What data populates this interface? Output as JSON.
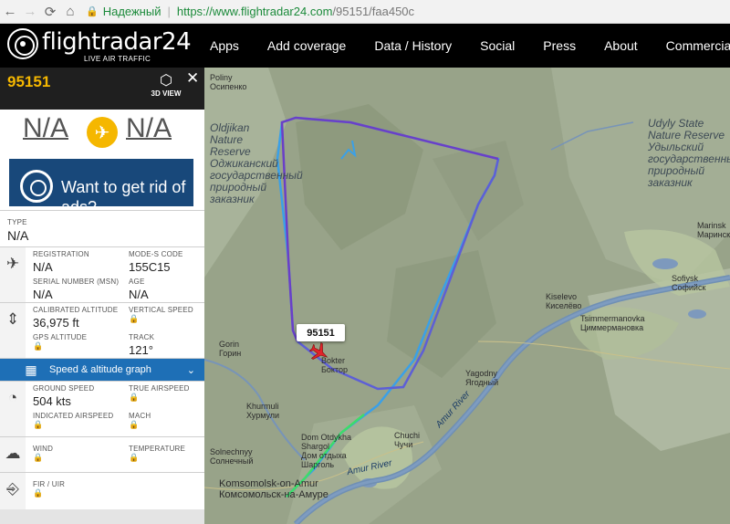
{
  "browser": {
    "back": "←",
    "forward": "→",
    "reload": "⟳",
    "home": "⌂",
    "secure_label": "Надежный",
    "url_host": "https://www.flightradar24.com",
    "url_path": "/95151/faa450c"
  },
  "header": {
    "logo_text": "flightradar24",
    "logo_sub": "LIVE AIR TRAFFIC",
    "nav": [
      "Apps",
      "Add coverage",
      "Data / History",
      "Social",
      "Press",
      "About",
      "Commercial"
    ]
  },
  "panel": {
    "flight_id": "95151",
    "view3d_label": "3D VIEW",
    "close": "✕",
    "route_from": "N/A",
    "route_to": "N/A",
    "ad_text": "Want to get rid of ads?",
    "type_label": "TYPE",
    "type_value": "N/A",
    "aircraft": {
      "registration_label": "REGISTRATION",
      "registration": "N/A",
      "mode_s_label": "MODE-S CODE",
      "mode_s": "155C15",
      "serial_label": "SERIAL NUMBER (MSN)",
      "serial": "N/A",
      "age_label": "AGE",
      "age": "N/A"
    },
    "altitude": {
      "calibrated_label": "CALIBRATED ALTITUDE",
      "calibrated": "36,975 ft",
      "vertical_label": "VERTICAL SPEED",
      "gps_label": "GPS ALTITUDE",
      "track_label": "TRACK",
      "track": "121°"
    },
    "graph_label": "Speed & altitude graph",
    "speed": {
      "ground_label": "GROUND SPEED",
      "ground": "504 kts",
      "true_label": "TRUE AIRSPEED",
      "indicated_label": "INDICATED AIRSPEED",
      "mach_label": "MACH"
    },
    "weather": {
      "wind_label": "WIND",
      "temp_label": "TEMPERATURE"
    },
    "fir_label": "FIR / UIR"
  },
  "map": {
    "callsign": "95151",
    "labels": {
      "poliny": "Poliny\nОсипенко",
      "oldjikan": "Oldjikan\nNature\nReserve\nОджиканский\nгосударственный\nприродный\nзаказник",
      "udyly": "Udyly State\nNature Reserve\nУдыльский\nгосударственный\nприродный\nзаказник",
      "marinsk": "Marinsk\nМаринск",
      "sofiysk": "Sofiysk\nСофийск",
      "kiselevo": "Kiselevo\nКиселёво",
      "tsimmer": "Tsimmermanovka\nЦиммермановка",
      "gorin": "Gorin\nГорин",
      "bokter": "Bokter\nБоктор",
      "yagodny": "Yagodny\nЯгодный",
      "khurmuli": "Khurmuli\nХурмули",
      "dom": "Dom Otdykha\nShargol\nДом отдыха\nШарголь",
      "chuchi": "Chuchi\nЧучи",
      "solnechny": "Solnechnyy\nСолнечный",
      "komsomolsk": "Komsomolsk-on-Amur\nКомсомольск-на-Амуре",
      "amur1": "Amur River",
      "amur2": "Amur River"
    }
  },
  "colors": {
    "accent": "#f5b700",
    "graph_bar": "#1e6fb6",
    "track_blue": "#3aa0e8",
    "track_purple": "#6a3fc8"
  }
}
